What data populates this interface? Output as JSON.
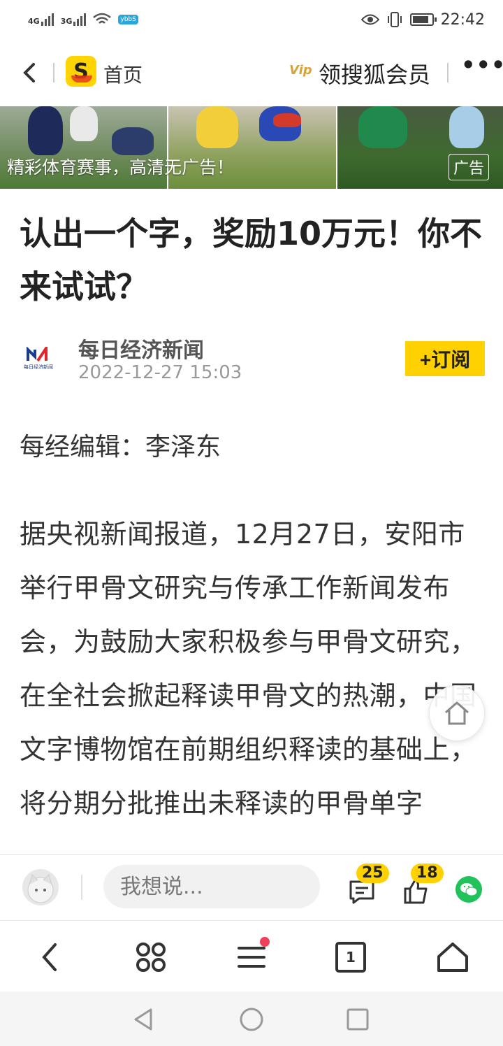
{
  "status_bar": {
    "network1": "4G",
    "network2": "3G",
    "app_badge": "ybbS",
    "time": "22:42",
    "icons": [
      "signal-icon",
      "wifi-icon",
      "eye-icon",
      "vibrate-icon",
      "battery-icon"
    ]
  },
  "nav": {
    "back_icon": "chevron-left-icon",
    "home_label": "首页",
    "vip_tag": "Vip",
    "member_label": "领搜狐会员",
    "more_icon": "more-dots-icon"
  },
  "ad_banner": {
    "text": "精彩体育赛事，高清无广告！",
    "badge": "广告"
  },
  "article": {
    "title": "认出一个字，奖励10万元！你不来试试？",
    "source_name": "每日经济新闻",
    "source_logo_text": "每日经济新闻",
    "publish_time": "2022-12-27 15:03",
    "subscribe_label": "+订阅",
    "editor_line": "每经编辑：李泽东",
    "body_text": "据央视新闻报道，12月27日，安阳市举行甲骨文研究与传承工作新闻发布会，为鼓励大家积极参与甲骨文研究，在全社会掀起释读甲骨文的热潮，中国文字博物馆在前期组织释读的基础上，将分期分批推出未释读的甲骨单字"
  },
  "comment_bar": {
    "placeholder": "我想说...",
    "comment_count": "25",
    "like_count": "18"
  },
  "browser_bar": {
    "tab_count": "1"
  }
}
